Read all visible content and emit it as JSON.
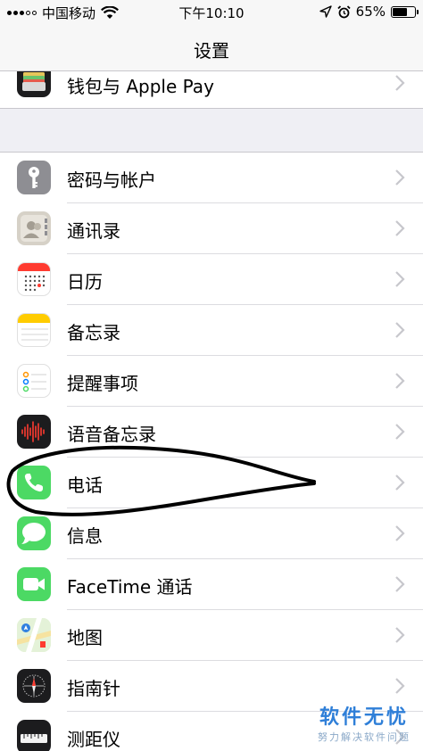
{
  "status_bar": {
    "carrier": "中国移动",
    "time": "下午10:10",
    "battery_percent": "65%",
    "battery_level": 0.65,
    "icons": [
      "signal-dots-icon",
      "wifi-icon",
      "location-arrow-icon",
      "alarm-clock-icon",
      "battery-icon"
    ]
  },
  "nav": {
    "title": "设置"
  },
  "top_group": {
    "items": [
      {
        "label": "钱包与 Apple Pay",
        "icon": "wallet-icon",
        "icon_color": "#1c1c1e"
      }
    ]
  },
  "main_group": {
    "items": [
      {
        "label": "密码与帐户",
        "icon": "key-icon",
        "icon_color": "#8e8e93"
      },
      {
        "label": "通讯录",
        "icon": "contacts-icon",
        "icon_color": "#c7c2b8"
      },
      {
        "label": "日历",
        "icon": "calendar-icon",
        "icon_color": "#ffffff"
      },
      {
        "label": "备忘录",
        "icon": "notes-icon",
        "icon_color": "#ffffff"
      },
      {
        "label": "提醒事项",
        "icon": "reminders-icon",
        "icon_color": "#ffffff"
      },
      {
        "label": "语音备忘录",
        "icon": "voice-memos-icon",
        "icon_color": "#1c1c1e"
      },
      {
        "label": "电话",
        "icon": "phone-icon",
        "icon_color": "#4cd964"
      },
      {
        "label": "信息",
        "icon": "messages-icon",
        "icon_color": "#4cd964"
      },
      {
        "label": "FaceTime 通话",
        "icon": "facetime-icon",
        "icon_color": "#4cd964"
      },
      {
        "label": "地图",
        "icon": "maps-icon",
        "icon_color": "#d9eec9"
      },
      {
        "label": "指南针",
        "icon": "compass-icon",
        "icon_color": "#1c1c1e"
      },
      {
        "label": "测距仪",
        "icon": "measure-icon",
        "icon_color": "#1c1c1e"
      }
    ]
  },
  "watermark": {
    "main": "软件无忧",
    "sub": "努力解决软件问题"
  },
  "colors": {
    "background": "#efeff4",
    "separator": "#c8c7cc",
    "chevron": "#c7c7cc",
    "watermark": "#2f7fd8"
  }
}
